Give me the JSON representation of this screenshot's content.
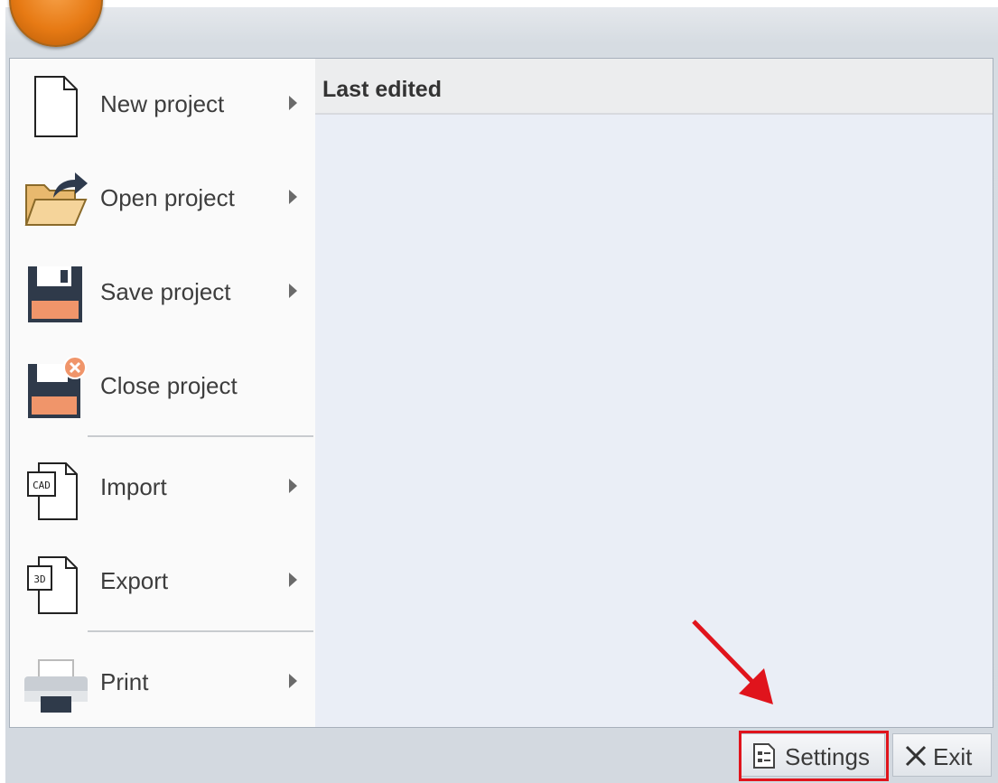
{
  "menu": {
    "items": [
      {
        "label": "New project",
        "icon": "blank-document-icon",
        "has_submenu": true
      },
      {
        "label": "Open project",
        "icon": "open-folder-icon",
        "has_submenu": true
      },
      {
        "label": "Save project",
        "icon": "floppy-disk-icon",
        "has_submenu": true
      },
      {
        "label": "Close project",
        "icon": "close-project-icon",
        "has_submenu": false
      },
      {
        "label": "Import",
        "icon": "cad-import-icon",
        "has_submenu": true
      },
      {
        "label": "Export",
        "icon": "3d-export-icon",
        "has_submenu": true
      },
      {
        "label": "Print",
        "icon": "printer-icon",
        "has_submenu": true
      }
    ]
  },
  "recent": {
    "header": "Last edited"
  },
  "footer": {
    "settings_label": "Settings",
    "exit_label": "Exit"
  },
  "icon_texts": {
    "cad": "CAD",
    "3d": "3D"
  },
  "colors": {
    "accent_orange": "#e77a14",
    "highlight_red": "#e0141c",
    "recent_bg": "#eaeef6"
  }
}
